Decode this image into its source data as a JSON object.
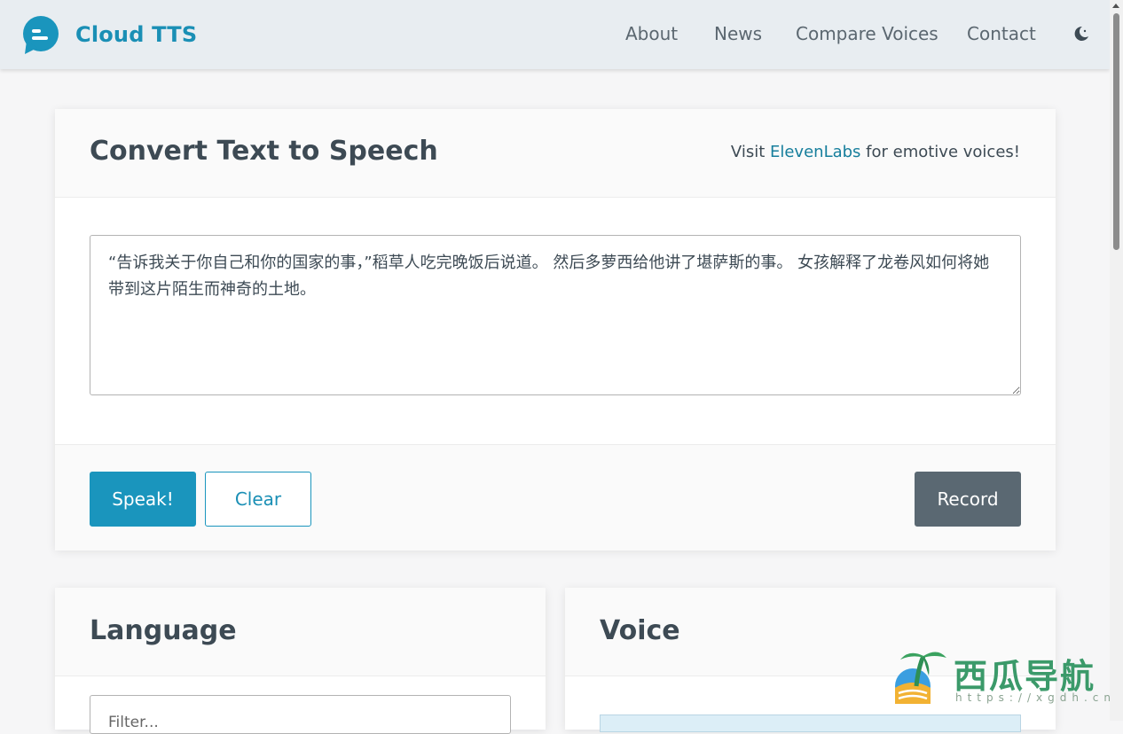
{
  "brand": {
    "name": "Cloud TTS",
    "logo_icon": "chat-bubble-icon"
  },
  "nav": {
    "links": [
      "About",
      "News",
      "Compare Voices",
      "Contact"
    ],
    "theme_icon": "moon-icon"
  },
  "main": {
    "title": "Convert Text to Speech",
    "visit_prefix": "Visit ",
    "visit_link": "ElevenLabs",
    "visit_suffix": " for emotive voices!",
    "text_value": "“告诉我关于你自己和你的国家的事，”稻草人吃完晚饭后说道。 然后多萝西给他讲了堪萨斯的事。 女孩解释了龙卷风如何将她带到这片陌生而神奇的土地。",
    "buttons": {
      "speak": "Speak!",
      "clear": "Clear",
      "record": "Record"
    }
  },
  "language": {
    "title": "Language",
    "filter_placeholder": "Filter..."
  },
  "voice": {
    "title": "Voice"
  },
  "watermark": {
    "title": "西瓜导航",
    "url": "https://xgdh.cn"
  },
  "colors": {
    "accent": "#1a95bd",
    "brand_text": "#1a8fb5",
    "record_button": "#5a6872",
    "nav_bg": "#e8edf1"
  }
}
